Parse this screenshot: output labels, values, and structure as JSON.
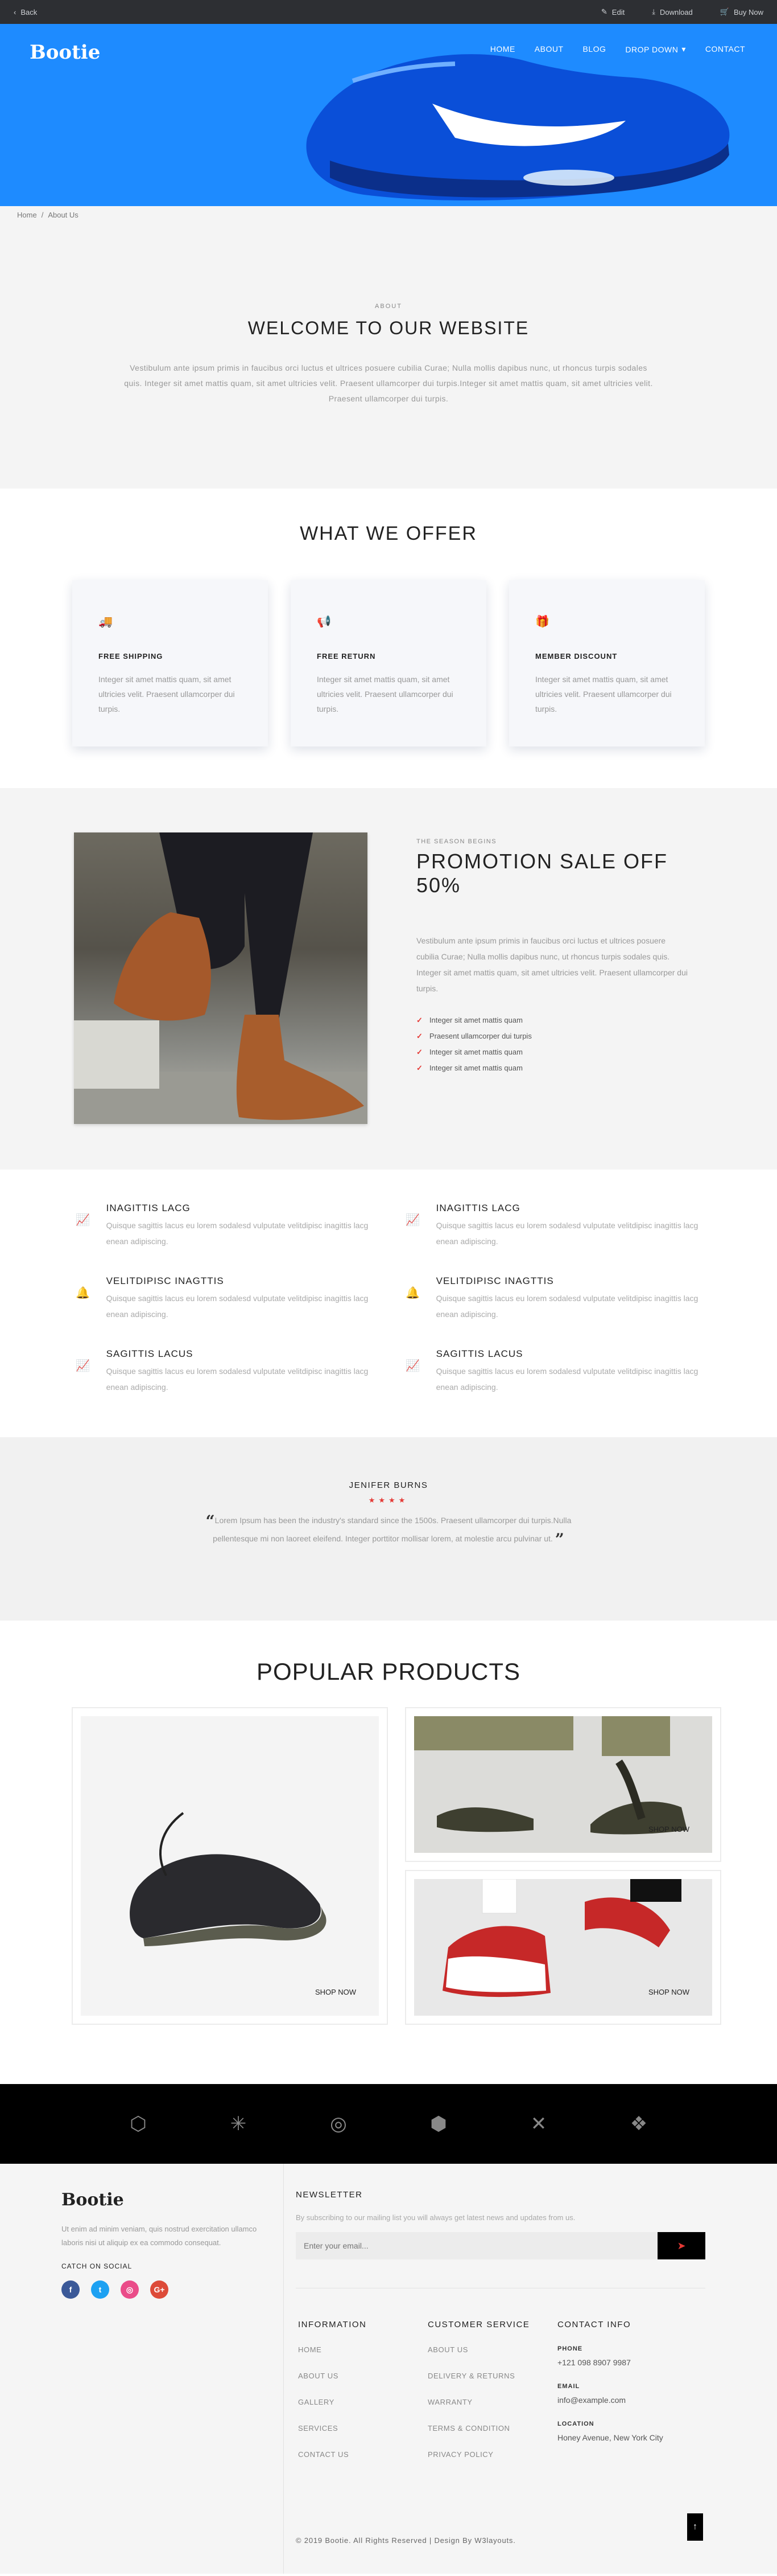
{
  "topbar": {
    "back": "Back",
    "edit": "Edit",
    "download": "Download",
    "buy": "Buy Now"
  },
  "brand": "Bootie",
  "nav": [
    "HOME",
    "ABOUT",
    "BLOG",
    "DROP DOWN",
    "CONTACT"
  ],
  "breadcrumb": {
    "home": "Home",
    "sep": "/",
    "current": "About Us"
  },
  "welcome": {
    "kicker": "ABOUT",
    "title": "WELCOME TO OUR WEBSITE",
    "body": "Vestibulum ante ipsum primis in faucibus orci luctus et ultrices posuere cubilia Curae; Nulla mollis dapibus nunc, ut rhoncus turpis sodales quis. Integer sit amet mattis quam, sit amet ultricies velit. Praesent ullamcorper dui turpis.Integer sit amet mattis quam, sit amet ultricies velit. Praesent ullamcorper dui turpis."
  },
  "offer": {
    "title": "WHAT WE OFFER",
    "cards": [
      {
        "icon": "truck-icon",
        "glyph": "🚚",
        "title": "FREE SHIPPING",
        "text": "Integer sit amet mattis quam, sit amet ultricies velit. Praesent ullamcorper dui turpis."
      },
      {
        "icon": "bullhorn-icon",
        "glyph": "📢",
        "title": "FREE RETURN",
        "text": "Integer sit amet mattis quam, sit amet ultricies velit. Praesent ullamcorper dui turpis."
      },
      {
        "icon": "gift-icon",
        "glyph": "🎁",
        "title": "MEMBER DISCOUNT",
        "text": "Integer sit amet mattis quam, sit amet ultricies velit. Praesent ullamcorper dui turpis."
      }
    ]
  },
  "promo": {
    "kicker": "THE SEASON BEGINS",
    "title": "PROMOTION SALE OFF 50%",
    "body": "Vestibulum ante ipsum primis in faucibus orci luctus et ultrices posuere cubilia Curae; Nulla mollis dapibus nunc, ut rhoncus turpis sodales quis. Integer sit amet mattis quam, sit amet ultricies velit. Praesent ullamcorper dui turpis.",
    "list": [
      "Integer sit amet mattis quam",
      "Praesent ullamcorper dui turpis",
      "Integer sit amet mattis quam",
      "Integer sit amet mattis quam"
    ]
  },
  "features": [
    {
      "icon": "line-chart-icon",
      "glyph": "📈",
      "title": "INAGITTIS LACG",
      "text": "Quisque sagittis lacus eu lorem sodalesd vulputate velitdipisc inagittis lacg enean adipiscing."
    },
    {
      "icon": "line-chart-icon",
      "glyph": "📈",
      "title": "INAGITTIS LACG",
      "text": "Quisque sagittis lacus eu lorem sodalesd vulputate velitdipisc inagittis lacg enean adipiscing."
    },
    {
      "icon": "bell-icon",
      "glyph": "🔔",
      "title": "VELITDIPISC INAGTTIS",
      "text": "Quisque sagittis lacus eu lorem sodalesd vulputate velitdipisc inagittis lacg enean adipiscing."
    },
    {
      "icon": "bell-icon",
      "glyph": "🔔",
      "title": "VELITDIPISC INAGTTIS",
      "text": "Quisque sagittis lacus eu lorem sodalesd vulputate velitdipisc inagittis lacg enean adipiscing."
    },
    {
      "icon": "line-chart-icon",
      "glyph": "📈",
      "title": "SAGITTIS LACUS",
      "text": "Quisque sagittis lacus eu lorem sodalesd vulputate velitdipisc inagittis lacg enean adipiscing."
    },
    {
      "icon": "line-chart-icon",
      "glyph": "📈",
      "title": "SAGITTIS LACUS",
      "text": "Quisque sagittis lacus eu lorem sodalesd vulputate velitdipisc inagittis lacg enean adipiscing."
    }
  ],
  "testimonial": {
    "name": "JENIFER BURNS",
    "stars": "★★★★",
    "text": "Lorem Ipsum has been the industry's standard since the 1500s. Praesent ullamcorper dui turpis.Nulla pellentesque mi non laoreet eleifend. Integer porttitor mollisar lorem, at molestie arcu pulvinar ut."
  },
  "products": {
    "title": "POPULAR PRODUCTS",
    "cta": "SHOP NOW"
  },
  "brands": [
    "brand-hexagon-icon",
    "brand-asterisk-icon",
    "brand-ring-icon",
    "brand-hex-icon",
    "brand-cross-icon",
    "brand-dropbox-icon"
  ],
  "footer": {
    "about": "Ut enim ad minim veniam, quis nostrud exercitation ullamco laboris nisi ut aliquip ex ea commodo consequat.",
    "catch": "CATCH ON SOCIAL",
    "socials": [
      {
        "name": "facebook-icon",
        "glyph": "f",
        "color": "#3b5998"
      },
      {
        "name": "twitter-icon",
        "glyph": "t",
        "color": "#1da1f2"
      },
      {
        "name": "dribbble-icon",
        "glyph": "◎",
        "color": "#ea4c89"
      },
      {
        "name": "google-plus-icon",
        "glyph": "G+",
        "color": "#dd4b39"
      }
    ],
    "newsletter": {
      "title": "NEWSLETTER",
      "text": "By subscribing to our mailing list you will always get latest news and updates from us.",
      "placeholder": "Enter your email..."
    },
    "information": {
      "title": "INFORMATION",
      "items": [
        "HOME",
        "ABOUT US",
        "GALLERY",
        "SERVICES",
        "CONTACT US"
      ]
    },
    "service": {
      "title": "CUSTOMER SERVICE",
      "items": [
        "ABOUT US",
        "DELIVERY & RETURNS",
        "WARRANTY",
        "TERMS & CONDITION",
        "PRIVACY POLICY"
      ]
    },
    "contact": {
      "title": "CONTACT INFO",
      "phone_label": "PHONE",
      "phone": "+121 098 8907 9987",
      "email_label": "EMAIL",
      "email": "info@example.com",
      "location_label": "LOCATION",
      "location": "Honey Avenue, New York City"
    },
    "copyright": "© 2019 Bootie. All Rights Reserved | Design By W3layouts."
  },
  "colors": {
    "hero": "#1e8bff",
    "accent": "#e53935",
    "icon": "#2447b8"
  }
}
